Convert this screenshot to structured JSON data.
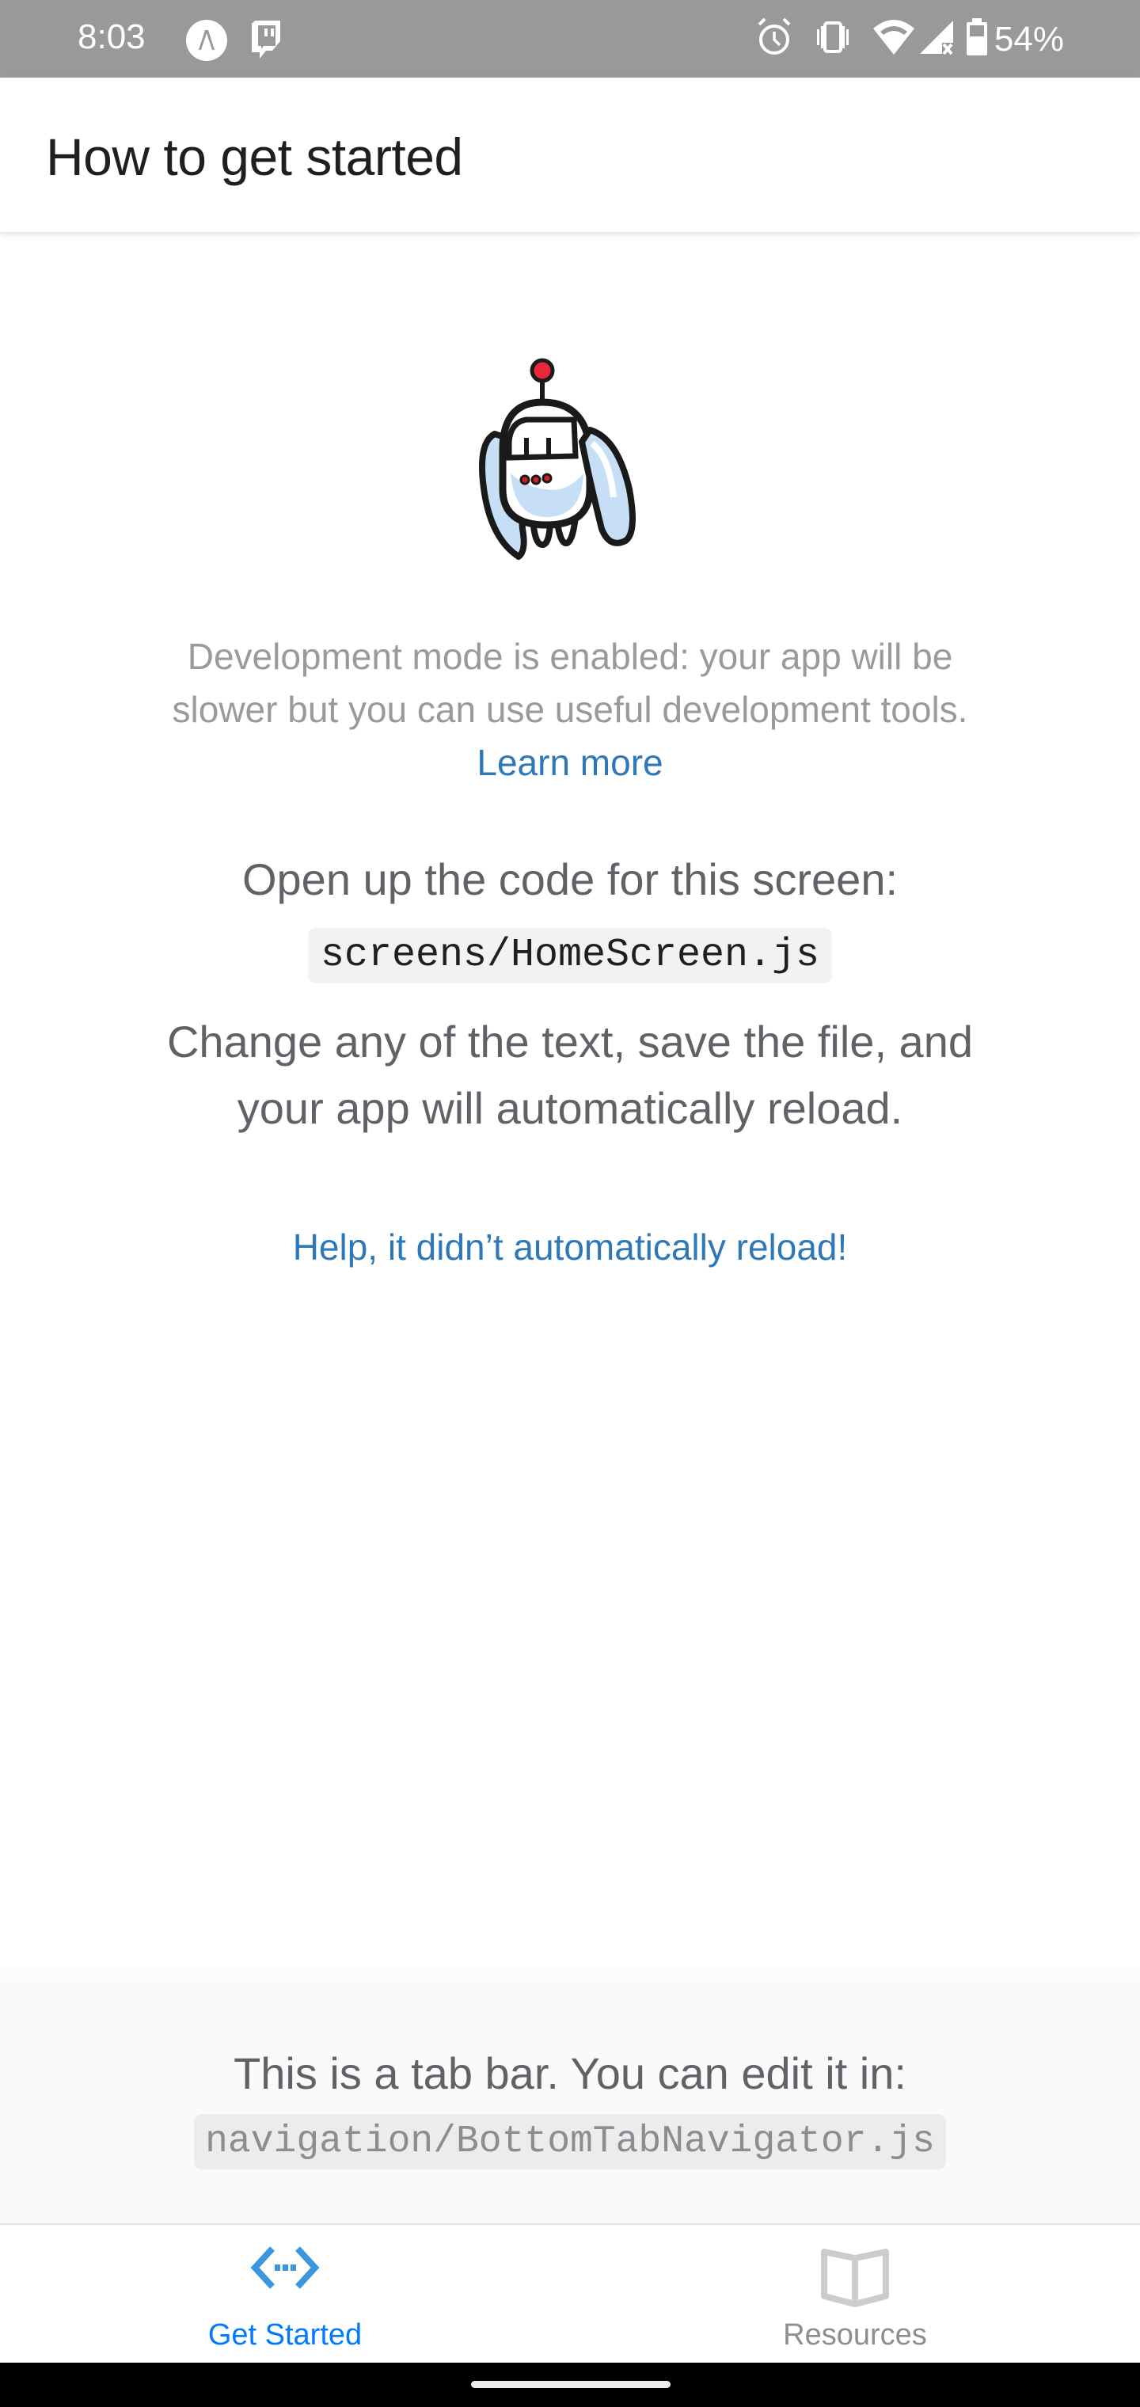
{
  "status_bar": {
    "time": "8:03",
    "left_icons": [
      "expo-a-icon",
      "twitch-icon"
    ],
    "right_icons": [
      "alarm-icon",
      "vibrate-icon",
      "wifi-icon",
      "signal-no-data-icon",
      "battery-icon"
    ],
    "battery_percent": "54%"
  },
  "header": {
    "title": "How to get started"
  },
  "main": {
    "illustration": "robot-dev-icon",
    "dev_mode_text": "Development mode is enabled: your app will be slower but you can use useful development tools.",
    "learn_more_label": "Learn more",
    "open_code_text": "Open up the code for this screen:",
    "file_path": "screens/HomeScreen.js",
    "change_text": "Change any of the text, save the file, and your app will automatically reload.",
    "help_link_label": "Help, it didn’t automatically reload!"
  },
  "tab_bar_info": {
    "text": "This is a tab bar. You can edit it in:",
    "file_path": "navigation/BottomTabNavigator.js"
  },
  "tabs": [
    {
      "label": "Get Started",
      "icon": "code-brackets-icon",
      "active": true
    },
    {
      "label": "Resources",
      "icon": "book-icon",
      "active": false
    }
  ],
  "colors": {
    "link": "#2e78b7",
    "tab_active": "#007aff",
    "tab_inactive": "#8e8e8e",
    "status_bar": "#999999"
  }
}
